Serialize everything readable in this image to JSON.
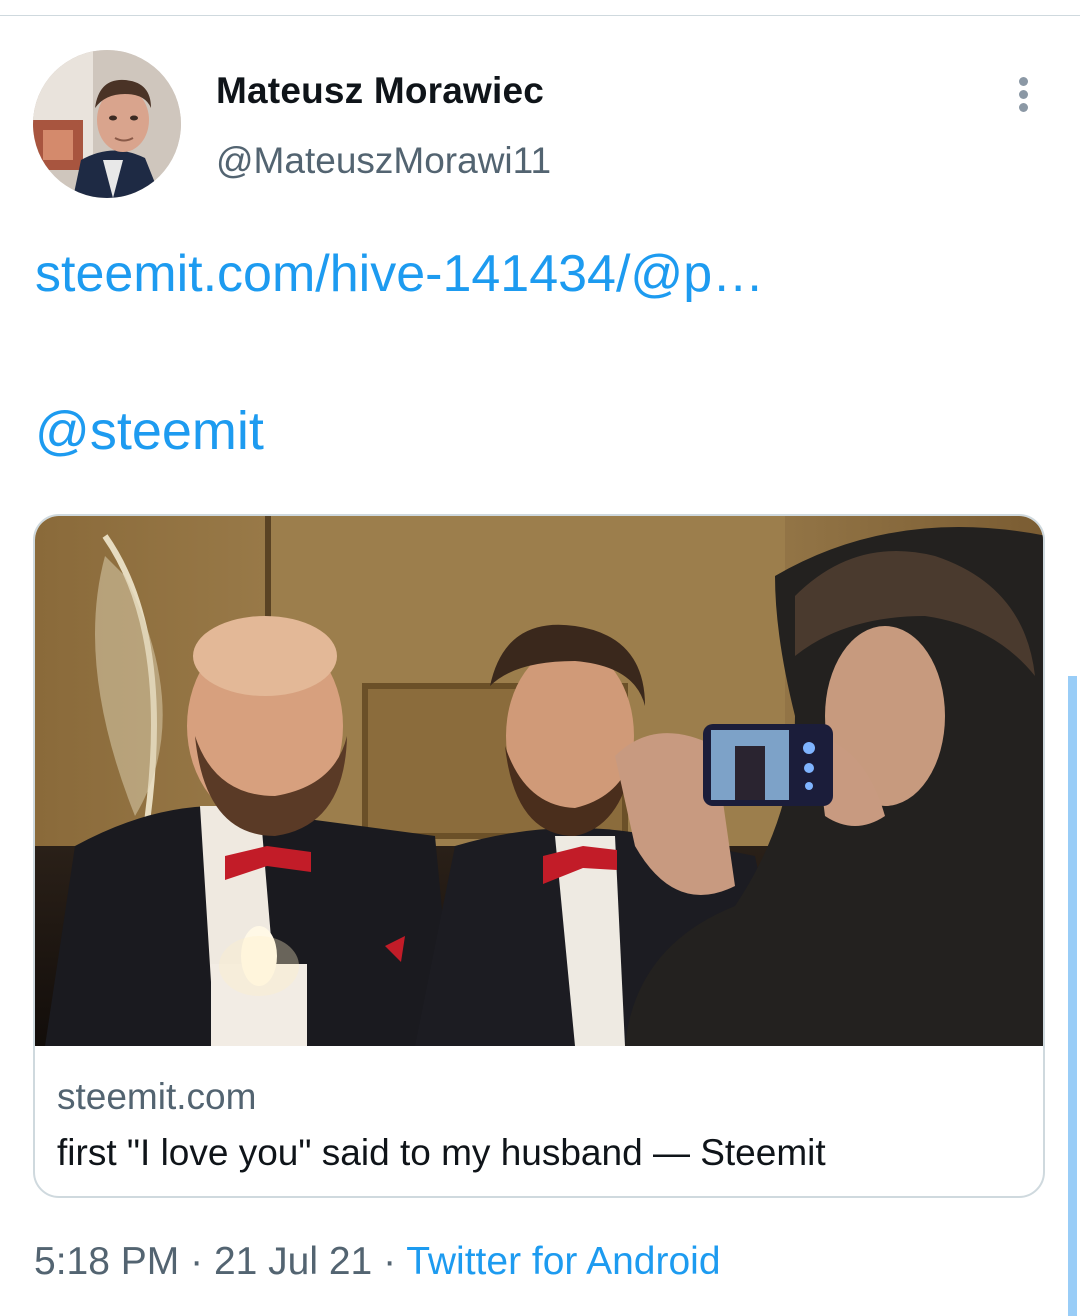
{
  "tweet": {
    "author": {
      "display_name": "Mateusz Morawiec",
      "handle": "@MateuszMorawi11"
    },
    "link_text": "steemit.com/hive-141434/@p…",
    "mention": "@steemit",
    "card": {
      "domain": "steemit.com",
      "title": "first \"I love you\" said to my husband — Steemit"
    },
    "meta": {
      "time": "5:18 PM",
      "separator": "·",
      "date": "21 Jul 21",
      "source": "Twitter for Android"
    }
  },
  "colors": {
    "link": "#1d9bf0",
    "secondary_text": "#536471",
    "primary_text": "#0f1419",
    "border": "#cfd9de"
  },
  "icons": {
    "more": "more-vertical-icon"
  }
}
